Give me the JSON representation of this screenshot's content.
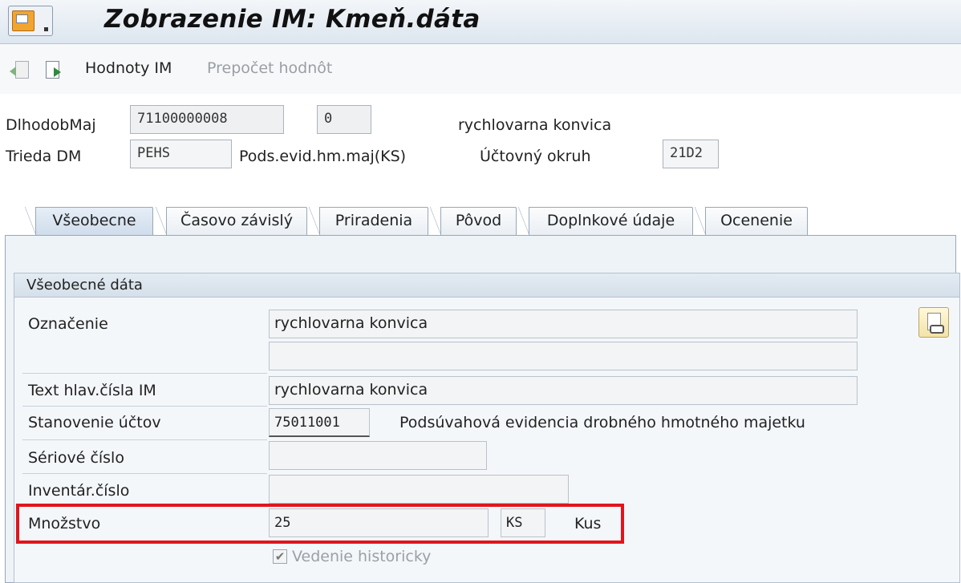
{
  "window": {
    "title": "Zobrazenie IM:  Kmeň.dáta"
  },
  "toolbar": {
    "icons": [
      "back-document-icon",
      "forward-document-icon"
    ],
    "values_label": "Hodnoty IM",
    "recalc_label": "Prepočet hodnôt"
  },
  "header": {
    "asset_label": "DlhodobMaj",
    "asset_number": "71100000008",
    "subnumber": "0",
    "asset_description": "rychlovarna konvica",
    "class_label": "Trieda DM",
    "class_value": "PEHS",
    "class_description": "Pods.evid.hm.maj(KS)",
    "chart_label": "Účtovný okruh",
    "chart_value": "21D2"
  },
  "tabs": [
    {
      "label": "Všeobecne",
      "active": true
    },
    {
      "label": "Časovo závislý",
      "active": false
    },
    {
      "label": "Priradenia",
      "active": false
    },
    {
      "label": "Pôvod",
      "active": false
    },
    {
      "label": "Doplnkové údaje",
      "active": false
    },
    {
      "label": "Ocenenie",
      "active": false
    }
  ],
  "general": {
    "group_title": "Všeobecné dáta",
    "designation_label": "Označenie",
    "designation_value": "rychlovarna konvica",
    "designation_value2": "",
    "main_text_label": "Text hlav.čísla IM",
    "main_text_value": "rychlovarna konvica",
    "acct_label": "Stanovenie účtov",
    "acct_value": "75011001",
    "acct_description": "Podsúvahová evidencia drobného hmotného majetku",
    "serial_label": "Sériové číslo",
    "serial_value": "",
    "inventory_label": "Inventár.číslo",
    "inventory_value": "",
    "quantity_label": "Množstvo",
    "quantity_value": "25",
    "unit_value": "KS",
    "unit_text": "Kus",
    "history_label": "Vedenie historicky",
    "history_checked": true
  },
  "colors": {
    "highlight": "#e0151c"
  }
}
